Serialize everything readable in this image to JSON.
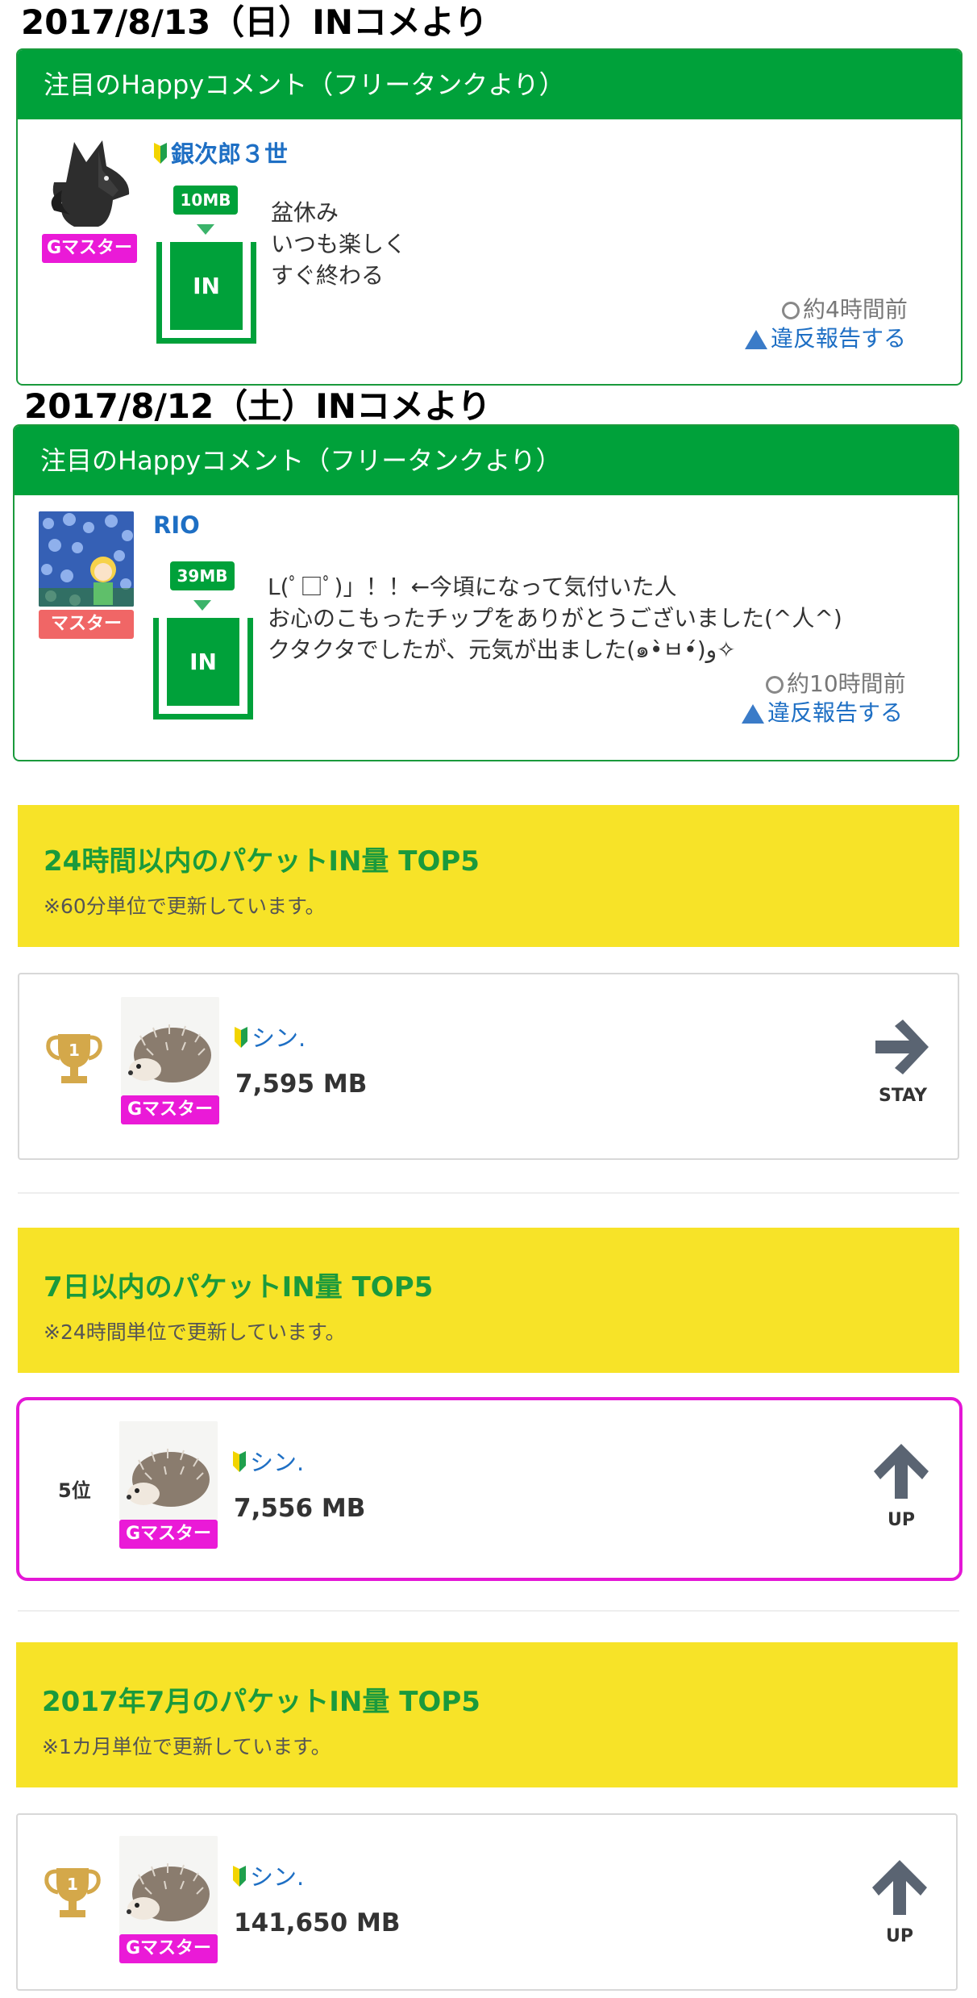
{
  "colors": {
    "accent_green": "#00a13a",
    "link_blue": "#1e6fc4",
    "badge_magenta": "#ea1ad7",
    "badge_red": "#f06666",
    "yellow": "#f7e328",
    "highlight_border": "#e417d6"
  },
  "section1": {
    "heading": "2017/8/13（日）INコメより",
    "card_title": "注目のHappyコメント（フリータンクより）",
    "user": {
      "name": "銀次郎３世",
      "rank": "Gマスター",
      "avatar_icon": "fox-avatar",
      "beginner_icon": "wakaba-icon"
    },
    "mb": "10MB",
    "tank_label": "IN",
    "comment": [
      "盆休み",
      "いつも楽しく",
      "すぐ終わる"
    ],
    "time": "約4時間前",
    "report": "違反報告する"
  },
  "section2": {
    "heading": "2017/8/12（土）INコメより",
    "card_title": "注目のHappyコメント（フリータンクより）",
    "user": {
      "name": "RIO",
      "rank": "マスター",
      "avatar_icon": "flower-avatar"
    },
    "mb": "39MB",
    "tank_label": "IN",
    "comment": [
      "L(ﾟ□ﾟ)」！！←今頃になって気付いた人",
      "お心のこもったチップをありがとうございました(^人^)",
      "クタクタでしたが、元気が出ました(๑•̀ㅂ•́)و✧"
    ],
    "time": "約10時間前",
    "report": "違反報告する"
  },
  "ranking24h": {
    "title": "24時間以内のパケットIN量 TOP5",
    "subtitle": "※60分単位で更新しています。",
    "entry": {
      "position": "1",
      "position_icon": "trophy-icon",
      "name": "シン.",
      "rank": "Gマスター",
      "mb": "7,595 MB",
      "trend": "STAY",
      "trend_icon": "arrow-right-icon"
    }
  },
  "ranking7d": {
    "title": "7日以内のパケットIN量 TOP5",
    "subtitle": "※24時間単位で更新しています。",
    "entry": {
      "position": "5位",
      "name": "シン.",
      "rank": "Gマスター",
      "mb": "7,556 MB",
      "trend": "UP",
      "trend_icon": "arrow-up-icon"
    }
  },
  "rankingMonth": {
    "title": "2017年7月のパケットIN量 TOP5",
    "subtitle": "※1カ月単位で更新しています。",
    "entry": {
      "position": "1",
      "position_icon": "trophy-icon",
      "name": "シン.",
      "rank": "Gマスター",
      "mb": "141,650 MB",
      "trend": "UP",
      "trend_icon": "arrow-up-icon"
    }
  }
}
